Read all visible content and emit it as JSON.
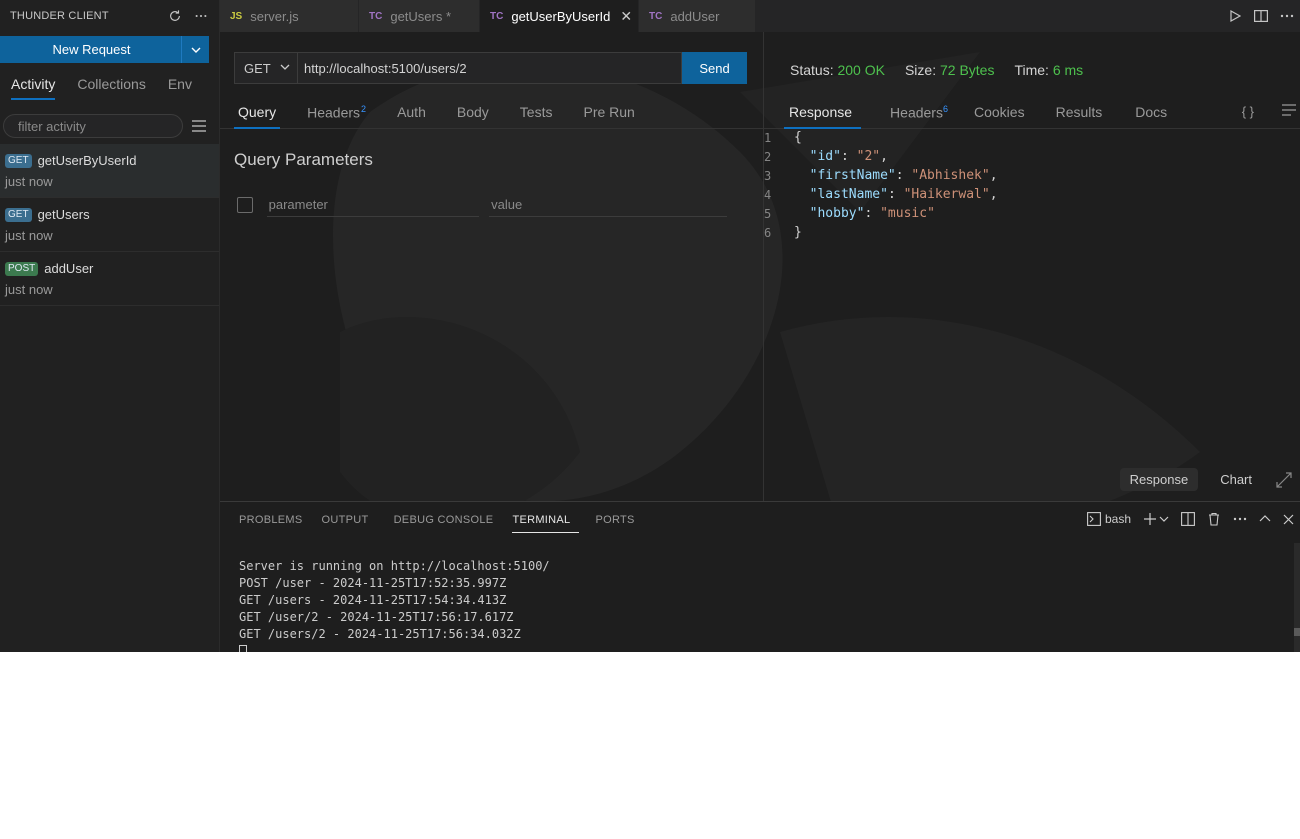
{
  "sidebar": {
    "title": "THUNDER CLIENT",
    "new_request_label": "New Request",
    "tabs": [
      {
        "label": "Activity"
      },
      {
        "label": "Collections"
      },
      {
        "label": "Env"
      }
    ],
    "filter_placeholder": "filter activity",
    "activity": [
      {
        "method": "GET",
        "name": "getUserByUserId",
        "time": "just now"
      },
      {
        "method": "GET",
        "name": "getUsers",
        "time": "just now"
      },
      {
        "method": "POST",
        "name": "addUser",
        "time": "just now"
      }
    ]
  },
  "editor_tabs": [
    {
      "type": "JS",
      "label": "server.js"
    },
    {
      "type": "TC",
      "label": "getUsers *"
    },
    {
      "type": "TC",
      "label": "getUserByUserId"
    },
    {
      "type": "TC",
      "label": "addUser"
    }
  ],
  "request": {
    "method": "GET",
    "url": "http://localhost:5100/users/2",
    "send_label": "Send",
    "tabs": [
      {
        "label": "Query"
      },
      {
        "label": "Headers",
        "count": "2"
      },
      {
        "label": "Auth"
      },
      {
        "label": "Body"
      },
      {
        "label": "Tests"
      },
      {
        "label": "Pre Run"
      }
    ],
    "query_title": "Query Parameters",
    "param_placeholder": "parameter",
    "value_placeholder": "value"
  },
  "response": {
    "status_label": "Status:",
    "status_value": "200 OK",
    "size_label": "Size:",
    "size_value": "72 Bytes",
    "time_label": "Time:",
    "time_value": "6 ms",
    "tabs": [
      {
        "label": "Response"
      },
      {
        "label": "Headers",
        "count": "6"
      },
      {
        "label": "Cookies"
      },
      {
        "label": "Results"
      },
      {
        "label": "Docs"
      }
    ],
    "braces_icon": "{ }",
    "line_numbers": [
      "1",
      "2",
      "3",
      "4",
      "5",
      "6"
    ],
    "json": {
      "open": "{",
      "close": "}",
      "fields": [
        {
          "key": "\"id\"",
          "value": "\"2\"",
          "sep": ","
        },
        {
          "key": "\"firstName\"",
          "value": "\"Abhishek\"",
          "sep": ","
        },
        {
          "key": "\"lastName\"",
          "value": "\"Haikerwal\"",
          "sep": ","
        },
        {
          "key": "\"hobby\"",
          "value": "\"music\"",
          "sep": ""
        }
      ]
    },
    "view_response_label": "Response",
    "view_chart_label": "Chart"
  },
  "panel": {
    "tabs": [
      {
        "label": "PROBLEMS"
      },
      {
        "label": "OUTPUT"
      },
      {
        "label": "DEBUG CONSOLE"
      },
      {
        "label": "TERMINAL"
      },
      {
        "label": "PORTS"
      }
    ],
    "shell_label": "bash",
    "terminal_lines": [
      "Server is running on http://localhost:5100/",
      "POST /user - 2024-11-25T17:52:35.997Z",
      "GET /users - 2024-11-25T17:54:34.413Z",
      "GET /user/2 - 2024-11-25T17:56:17.617Z",
      "GET /users/2 - 2024-11-25T17:56:34.032Z"
    ]
  },
  "colors": {
    "accent": "#0e639c",
    "status_ok": "#4ec14e",
    "json_key": "#9cdcfe",
    "json_string": "#ce9178"
  }
}
